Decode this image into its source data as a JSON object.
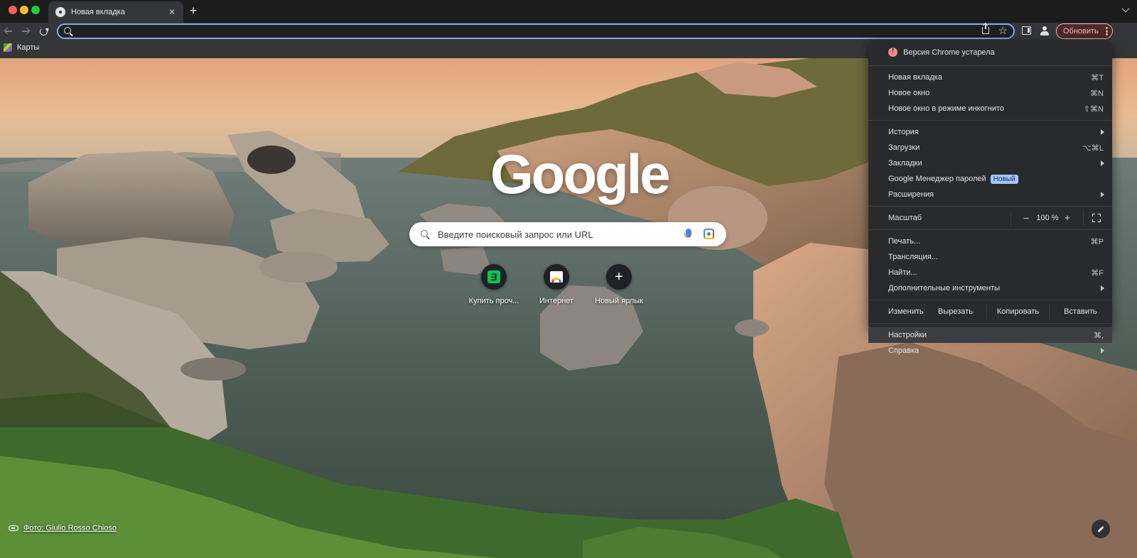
{
  "tab": {
    "title": "Новая вкладка",
    "close": "✕"
  },
  "tabstrip": {
    "new_tab": "+"
  },
  "omnibox": {
    "value": "",
    "placeholder": ""
  },
  "toolbar": {
    "update_label": "Обновить"
  },
  "bookmarks": [
    {
      "label": "Карты",
      "icon": "maps-icon"
    }
  ],
  "ntp": {
    "logo": "Google",
    "search_placeholder": "Введите поисковый запрос или URL",
    "shortcuts": [
      {
        "label": "Купить проч...",
        "icon": "evernote-icon",
        "glyph": "Ǝ"
      },
      {
        "label": "Интернет",
        "icon": "rainbow-icon"
      },
      {
        "label": "Новый ярлык",
        "icon": "plus-icon",
        "glyph": "+"
      }
    ],
    "photo_credit": "Фото: Giulio Rosso Chioso"
  },
  "menu": {
    "warning": "Версия Chrome устарела",
    "new_tab": {
      "label": "Новая вкладка",
      "shortcut": "⌘T"
    },
    "new_window": {
      "label": "Новое окно",
      "shortcut": "⌘N"
    },
    "incognito": {
      "label": "Новое окно в режиме инкогнито",
      "shortcut": "⇧⌘N"
    },
    "history": {
      "label": "История"
    },
    "downloads": {
      "label": "Загрузки",
      "shortcut": "⌥⌘L"
    },
    "bookmarks": {
      "label": "Закладки"
    },
    "passwords": {
      "label": "Google Менеджер паролей",
      "badge": "Новый"
    },
    "extensions": {
      "label": "Расширения"
    },
    "zoom": {
      "label": "Масштаб",
      "minus": "–",
      "value": "100 %",
      "plus": "+"
    },
    "print": {
      "label": "Печать...",
      "shortcut": "⌘P"
    },
    "cast": {
      "label": "Трансляция..."
    },
    "find": {
      "label": "Найти...",
      "shortcut": "⌘F"
    },
    "more_tools": {
      "label": "Дополнительные инструменты"
    },
    "edit": {
      "label": "Изменить",
      "cut": "Вырезать",
      "copy": "Копировать",
      "paste": "Вставить"
    },
    "settings": {
      "label": "Настройки",
      "shortcut": "⌘,"
    },
    "help": {
      "label": "Справка"
    }
  },
  "colors": {
    "accent": "#7cacf8",
    "update": "#f2b8b5",
    "menu_bg": "#292a2d"
  }
}
